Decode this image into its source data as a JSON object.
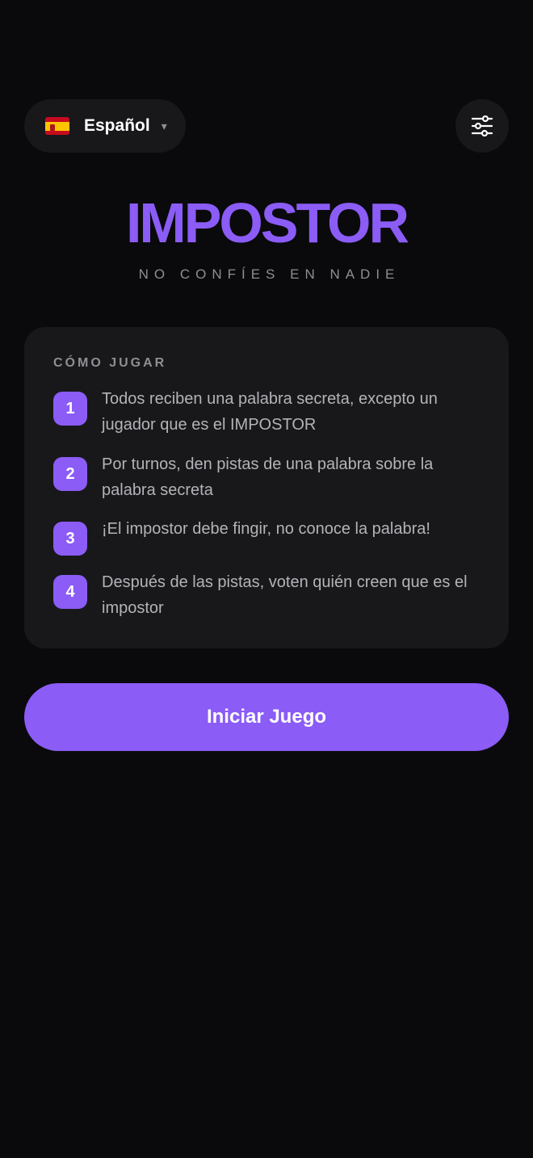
{
  "header": {
    "language": {
      "label": "Español",
      "flag_icon": "spain-flag-icon",
      "chevron": "▾"
    },
    "settings_icon": "sliders-icon"
  },
  "hero": {
    "title": "IMPOSTOR",
    "tagline": "NO CONFÍES EN NADIE"
  },
  "how_to_play": {
    "heading": "CÓMO JUGAR",
    "steps": [
      {
        "number": "1",
        "text": "Todos reciben una palabra secreta, excepto un jugador que es el IMPOSTOR"
      },
      {
        "number": "2",
        "text": "Por turnos, den pistas de una palabra sobre la palabra secreta"
      },
      {
        "number": "3",
        "text": "¡El impostor debe fingir, no conoce la palabra!"
      },
      {
        "number": "4",
        "text": "Después de las pistas, voten quién creen que es el impostor"
      }
    ]
  },
  "start_button": {
    "label": "Iniciar Juego"
  },
  "colors": {
    "background": "#0a0a0c",
    "surface": "#18181b",
    "accent": "#8b5cf6",
    "muted_text": "#8e8e93",
    "body_text": "#b3b3b8"
  }
}
